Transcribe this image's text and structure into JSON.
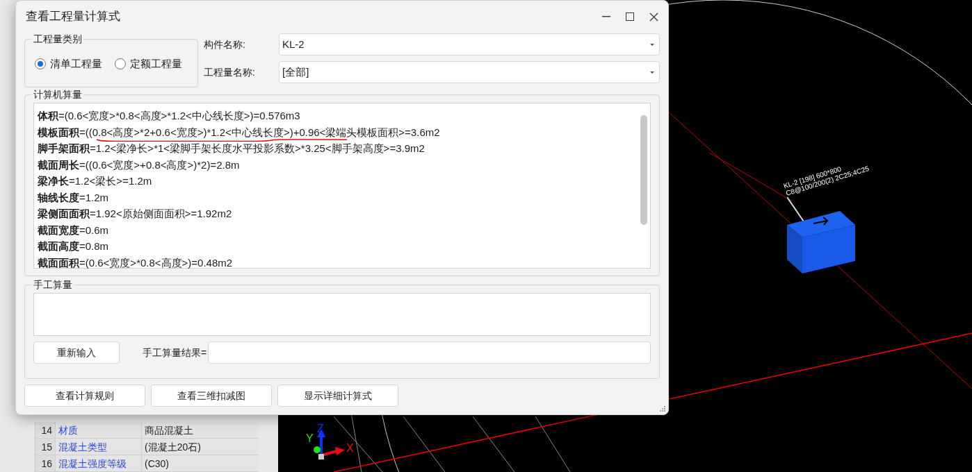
{
  "dialog": {
    "title": "查看工程量计算式",
    "quantity_type": {
      "legend": "工程量类别",
      "options": [
        {
          "label": "清单工程量",
          "selected": true
        },
        {
          "label": "定额工程量",
          "selected": false
        }
      ]
    },
    "fields": [
      {
        "label": "构件名称:",
        "value": "KL-2"
      },
      {
        "label": "工程量名称:",
        "value": "[全部]"
      }
    ],
    "computed": {
      "legend": "计算机算量",
      "lines": [
        {
          "name": "体积",
          "formula": "=(0.6<宽度>*0.8<高度>*1.2<中心线长度>)=0.576m3"
        },
        {
          "name": "模板面积",
          "formula": "=((0.8<高度>*2+0.6<宽度>)*1.2<中心线长度>)+0.96<梁端头模板面积>=3.6m2"
        },
        {
          "name": "脚手架面积",
          "formula": "=1.2<梁净长>*1<梁脚手架长度水平投影系数>*3.25<脚手架高度>=3.9m2"
        },
        {
          "name": "截面周长",
          "formula": "=((0.6<宽度>+0.8<高度>)*2)=2.8m"
        },
        {
          "name": "梁净长",
          "formula": "=1.2<梁长>=1.2m"
        },
        {
          "name": "轴线长度",
          "formula": "=1.2m"
        },
        {
          "name": "梁侧面面积",
          "formula": "=1.92<原始侧面面积>=1.92m2"
        },
        {
          "name": "截面宽度",
          "formula": "=0.6m"
        },
        {
          "name": "截面高度",
          "formula": "=0.8m"
        },
        {
          "name": "截面面积",
          "formula": "=(0.6<宽度>*0.8<高度>)=0.48m2"
        }
      ]
    },
    "manual": {
      "legend": "手工算量",
      "reset_button": "重新输入",
      "result_label": "手工算量结果="
    },
    "buttons": [
      "查看计算规则",
      "查看三维扣减图",
      "显示详细计算式"
    ]
  },
  "property_table": {
    "rows": [
      {
        "index": "14",
        "name": "材质",
        "value": "商品混凝土"
      },
      {
        "index": "15",
        "name": "混凝土类型",
        "value": "(混凝土20石)"
      },
      {
        "index": "16",
        "name": "混凝土强度等级",
        "value": "(C30)"
      }
    ]
  },
  "viewport": {
    "beam_label": [
      "KL-2 [198] 600*800",
      "C8@100/200(2) 2C25;4C25"
    ],
    "axes": [
      "X",
      "Y",
      "Z"
    ]
  }
}
